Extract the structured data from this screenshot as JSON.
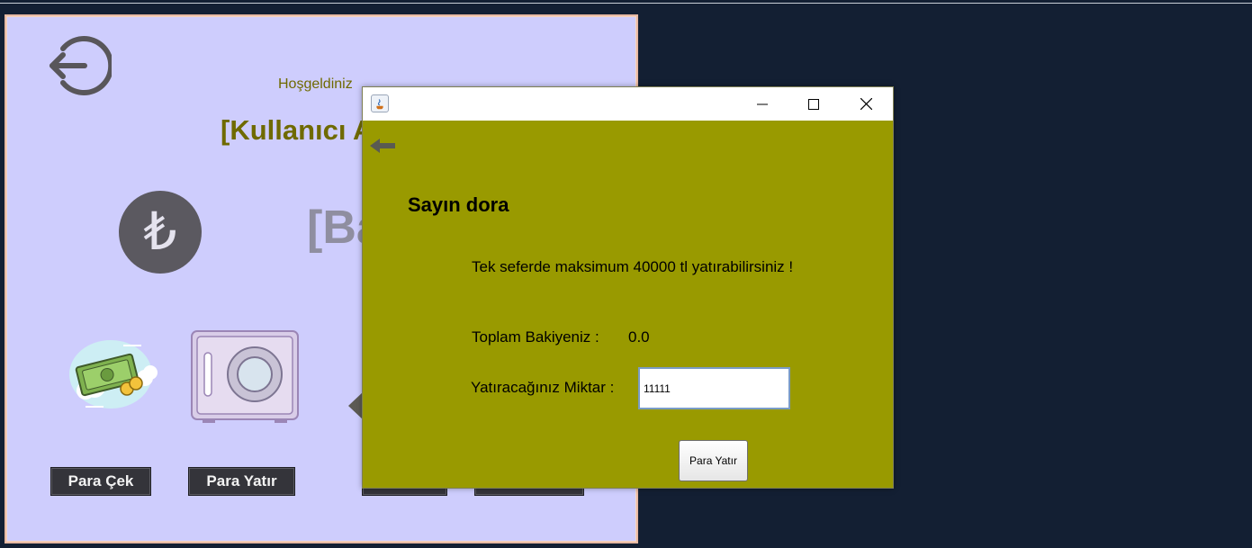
{
  "main_window": {
    "welcome": "Hoşgeldiniz",
    "user_name": "[Kullanıcı A",
    "lira_symbol": "₺",
    "balance_label": "[Ba",
    "buttons": {
      "withdraw": "Para Çek",
      "deposit": "Para Yatır"
    }
  },
  "dialog": {
    "greeting": "Sayın dora",
    "info": "Tek seferde maksimum 40000 tl yatırabilirsiniz !",
    "balance_label": "Toplam Bakiyeniz :",
    "balance_value": "0.0",
    "amount_label": "Yatıracağınız Miktar :",
    "amount_value": "11111",
    "deposit_button": "Para Yatır"
  },
  "icons": {
    "logout": "logout-icon",
    "lira": "lira-icon",
    "money": "money-icon",
    "safe": "safe-icon",
    "back": "back-arrow-icon",
    "app": "java-icon",
    "minimize": "minimize-icon",
    "maximize": "maximize-icon",
    "close": "close-icon"
  },
  "colors": {
    "desktop": "#131f33",
    "main_bg": "#cecdfd",
    "dialog_bg": "#999a00",
    "title_text": "#6f6a00",
    "dark_button": "#34343a"
  }
}
